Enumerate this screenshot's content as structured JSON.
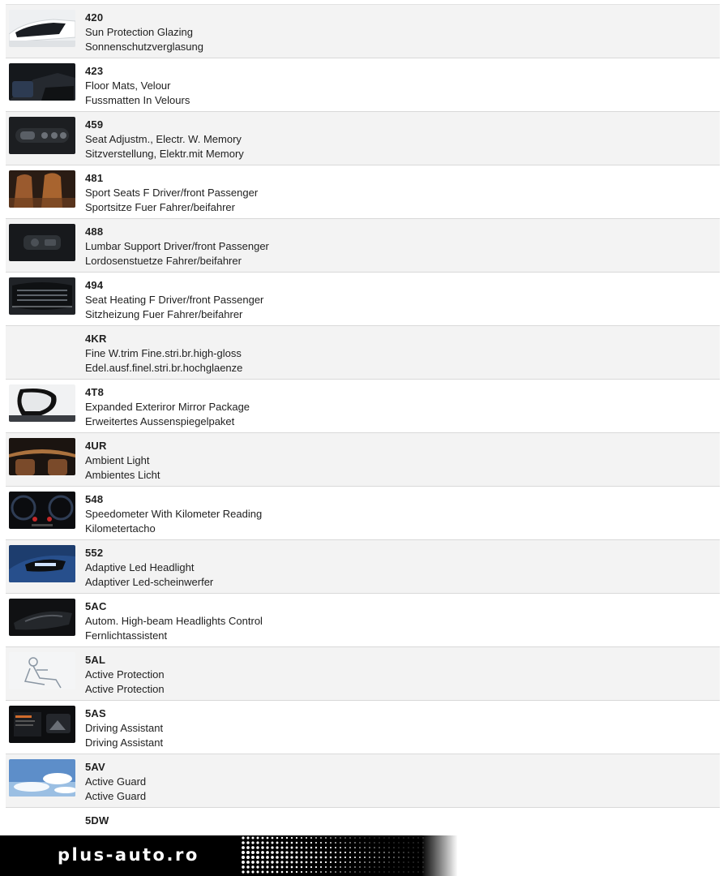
{
  "options": [
    {
      "code": "420",
      "name_en": "Sun Protection Glazing",
      "name_de": "Sonnenschutzverglasung",
      "thumbnail": "car-rear-window-image"
    },
    {
      "code": "423",
      "name_en": "Floor Mats, Velour",
      "name_de": "Fussmatten In Velours",
      "thumbnail": "car-interior-floor-image"
    },
    {
      "code": "459",
      "name_en": "Seat Adjustm., Electr. W. Memory",
      "name_de": "Sitzverstellung, Elektr.mit Memory",
      "thumbnail": "seat-memory-buttons-image"
    },
    {
      "code": "481",
      "name_en": "Sport Seats F Driver/front Passenger",
      "name_de": "Sportsitze Fuer Fahrer/beifahrer",
      "thumbnail": "brown-sport-seats-image"
    },
    {
      "code": "488",
      "name_en": "Lumbar Support Driver/front Passenger",
      "name_de": "Lordosenstuetze Fahrer/beifahrer",
      "thumbnail": "lumbar-switch-image"
    },
    {
      "code": "494",
      "name_en": "Seat Heating F Driver/front Passenger",
      "name_de": "Sitzheizung Fuer Fahrer/beifahrer",
      "thumbnail": "air-vent-controls-image"
    },
    {
      "code": "4KR",
      "name_en": "Fine W.trim Fine.stri.br.high-gloss",
      "name_de": "Edel.ausf.finel.stri.br.hochglaenze",
      "thumbnail": ""
    },
    {
      "code": "4T8",
      "name_en": "Expanded Exteriror Mirror Package",
      "name_de": "Erweitertes Aussenspiegelpaket",
      "thumbnail": "side-mirror-image"
    },
    {
      "code": "4UR",
      "name_en": "Ambient Light",
      "name_de": "Ambientes Licht",
      "thumbnail": "ambient-interior-image"
    },
    {
      "code": "548",
      "name_en": "Speedometer With Kilometer Reading",
      "name_de": "Kilometertacho",
      "thumbnail": "instrument-cluster-image"
    },
    {
      "code": "552",
      "name_en": "Adaptive Led Headlight",
      "name_de": "Adaptiver Led-scheinwerfer",
      "thumbnail": "blue-car-headlight-image"
    },
    {
      "code": "5AC",
      "name_en": "Autom. High-beam Headlights Control",
      "name_de": "Fernlichtassistent",
      "thumbnail": "dark-headlight-image"
    },
    {
      "code": "5AL",
      "name_en": "Active Protection",
      "name_de": "Active Protection",
      "thumbnail": "seated-occupant-sketch-image"
    },
    {
      "code": "5AS",
      "name_en": "Driving Assistant",
      "name_de": "Driving Assistant",
      "thumbnail": "assistant-display-image"
    },
    {
      "code": "5AV",
      "name_en": "Active Guard",
      "name_de": "Active Guard",
      "thumbnail": "sky-clouds-image"
    },
    {
      "code": "5DW",
      "name_en": "",
      "name_de": "",
      "thumbnail": ""
    }
  ],
  "footer": {
    "brand": "plus-auto.ro",
    "bg_color": "#000000",
    "text_color": "#ffffff"
  },
  "colors": {
    "row_alt": "#f3f3f3",
    "row": "#ffffff",
    "divider": "#d9d9d9"
  }
}
